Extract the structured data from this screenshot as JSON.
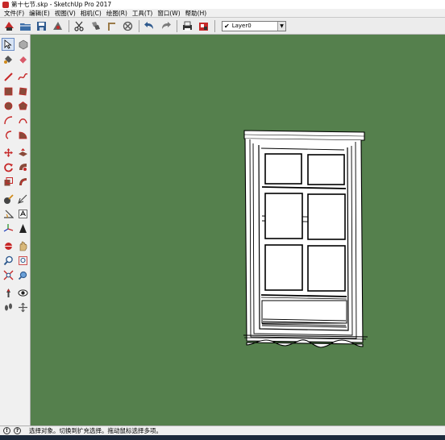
{
  "titlebar": {
    "title": "第十七节.skp - SketchUp Pro 2017"
  },
  "menu": {
    "items": [
      "文件(F)",
      "编辑(E)",
      "视图(V)",
      "相机(C)",
      "绘图(R)",
      "工具(T)",
      "窗口(W)",
      "帮助(H)"
    ]
  },
  "toolbar": {
    "layer_selected": "Layer0",
    "layer_check": "✔",
    "dropdown_arrow": "▼"
  },
  "status": {
    "icon_info": "!",
    "icon_help": "?",
    "message": "选择对象。切换到扩充选择。拖动鼠标选择多项。"
  },
  "colors": {
    "viewport_bg": "#55804d",
    "accent_red": "#c62828"
  }
}
